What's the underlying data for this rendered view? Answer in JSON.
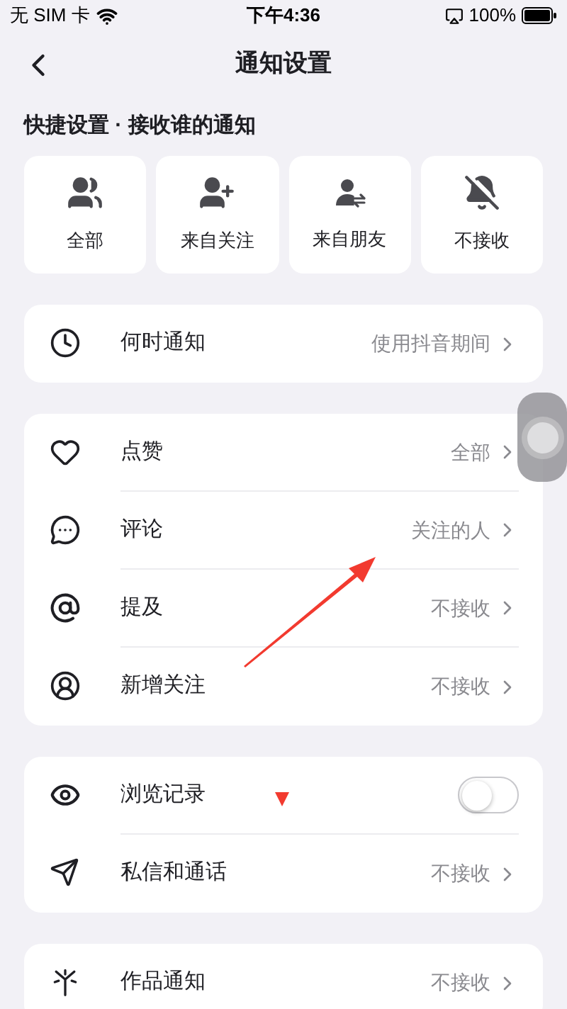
{
  "status_bar": {
    "carrier": "无 SIM 卡",
    "time": "下午4:36",
    "battery": "100%"
  },
  "nav": {
    "title": "通知设置"
  },
  "quick": {
    "title": "快捷设置 · 接收谁的通知",
    "options": [
      {
        "label": "全部"
      },
      {
        "label": "来自关注"
      },
      {
        "label": "来自朋友"
      },
      {
        "label": "不接收"
      }
    ]
  },
  "groups": [
    {
      "rows": [
        {
          "kind": "link",
          "label": "何时通知",
          "value": "使用抖音期间"
        }
      ]
    },
    {
      "rows": [
        {
          "kind": "link",
          "label": "点赞",
          "value": "全部"
        },
        {
          "kind": "link",
          "label": "评论",
          "value": "关注的人"
        },
        {
          "kind": "link",
          "label": "提及",
          "value": "不接收"
        },
        {
          "kind": "link",
          "label": "新增关注",
          "value": "不接收"
        }
      ]
    },
    {
      "rows": [
        {
          "kind": "toggle",
          "label": "浏览记录",
          "on": false
        },
        {
          "kind": "link",
          "label": "私信和通话",
          "value": "不接收"
        }
      ]
    },
    {
      "rows": [
        {
          "kind": "link",
          "label": "作品通知",
          "value": "不接收"
        }
      ]
    }
  ]
}
